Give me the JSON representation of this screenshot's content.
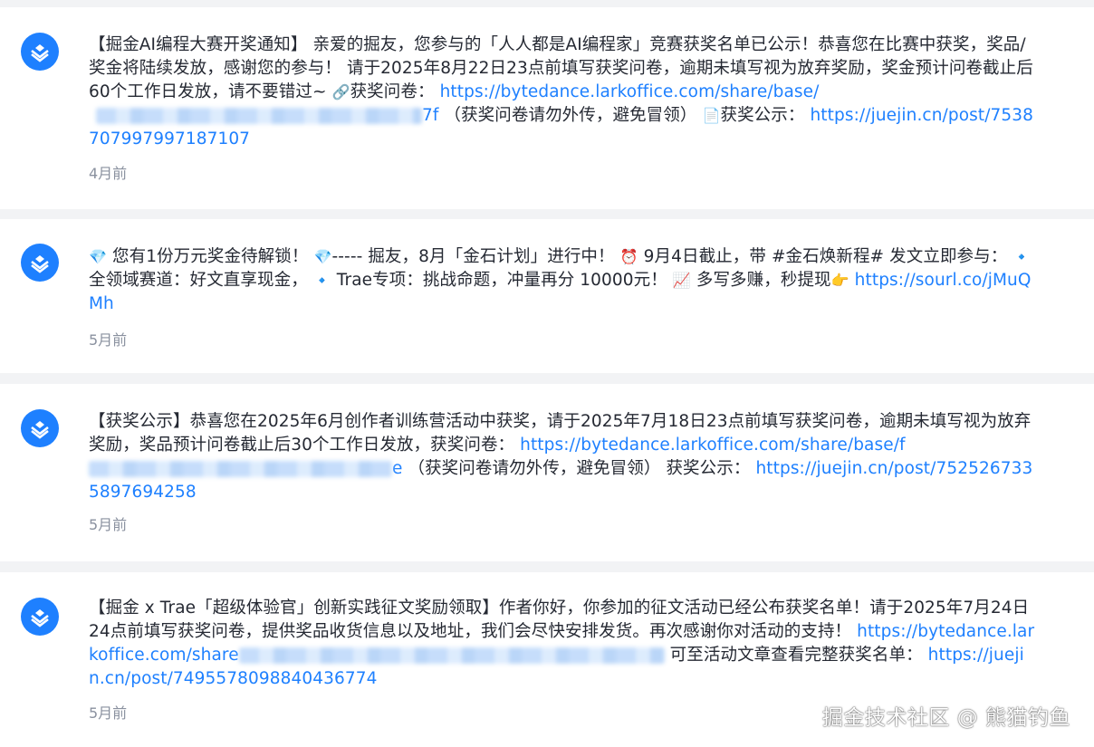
{
  "notifications": [
    {
      "pre": "【掘金AI编程大赛开奖通知】 亲爱的掘友，您参与的「人人都是AI编程家」竞赛获奖名单已公示！恭喜您在比赛中获奖，奖品/奖金将陆续发放，感谢您的参与！ 请于2025年8月22日23点前填写获奖问卷，逾期未填写视为放弃奖励，奖金预计问卷截止后60个工作日发放，请不要错过~ ",
      "emoji1": "🔗",
      "label1": "获奖问卷：",
      "link1": "https://bytedance.larkoffice.com/share/base/",
      "link1_tail": "7f",
      "mid": " （获奖问卷请勿外传，避免冒领） ",
      "emoji2": "📄",
      "label2": "获奖公示：",
      "link2": "https://juejin.cn/post/7538707997997187107",
      "time": "4月前"
    },
    {
      "e1": "💎",
      "t1": " 您有1份万元奖金待解锁！ ",
      "e2": "💎",
      "t2": "----- 掘友，8月「金石计划」进行中！ ",
      "e3": "⏰",
      "t3": " 9月4日截止，带 #金石焕新程# 发文立即参与： ",
      "e4": "🔹",
      "t4": " 全领域赛道：好文直享现金， ",
      "e5": "🔹",
      "t5": " Trae专项：挑战命题，冲量再分 10000元！ ",
      "e6": "📈",
      "t6": " 多写多赚，秒提现",
      "e7": "👉",
      "link": " https://sourl.co/jMuQMh",
      "time": "5月前"
    },
    {
      "pre": "【获奖公示】恭喜您在2025年6月创作者训练营活动中获奖，请于2025年7月18日23点前填写获奖问卷，逾期未填写视为放弃奖励，奖品预计问卷截止后30个工作日发放，获奖问卷： ",
      "link1": "https://bytedance.larkoffice.com/share/base/f",
      "link1_tail": "e",
      "mid": " （获奖问卷请勿外传，避免冒领） 获奖公示： ",
      "link2": "https://juejin.cn/post/7525267335897694258",
      "time": "5月前"
    },
    {
      "pre": "【掘金 x Trae「超级体验官」创新实践征文奖励领取】作者你好，你参加的征文活动已经公布获奖名单！请于2025年7月24日24点前填写获奖问卷，提供奖品收货信息以及地址，我们会尽快安排发货。再次感谢你对活动的支持！ ",
      "link1": "https://bytedance.larkoffice.com/share",
      "mid": " 可至活动文章查看完整获奖名单： ",
      "link2": "https://juejin.cn/post/7495578098840436774",
      "time": "5月前"
    }
  ],
  "watermark": "掘金技术社区 @ 熊猫钓鱼",
  "colors": {
    "accent": "#1e80ff",
    "text": "#252933",
    "muted": "#8a919f",
    "bg": "#f2f3f5"
  }
}
